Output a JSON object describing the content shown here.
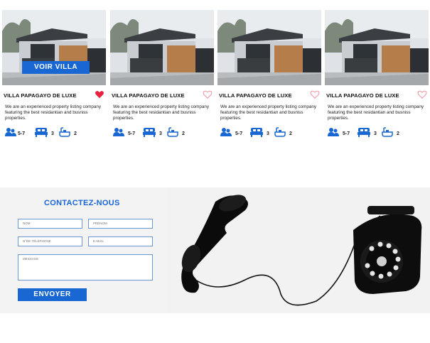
{
  "listings": [
    {
      "title": "VILLA PAPAGAYO DE LUXE",
      "favorited": true,
      "overlay_label": "VOIR VILLA",
      "description": "We are an experienced property listing company featuring the best residantian and busniss properties.",
      "guests": "5-7",
      "beds": "3",
      "baths": "2"
    },
    {
      "title": "VILLA PAPAGAYO DE LUXE",
      "favorited": false,
      "description": "We are an experienced property listing company featuring the best residantian and busniss properties.",
      "guests": "5-7",
      "beds": "3",
      "baths": "2"
    },
    {
      "title": "VILLA PAPAGAYO DE LUXE",
      "favorited": false,
      "description": "We are an experienced property listing company featuring the best residantian and busniss properties.",
      "guests": "5-7",
      "beds": "3",
      "baths": "2"
    },
    {
      "title": "VILLA PAPAGAYO DE LUXE",
      "favorited": false,
      "description": "We are an experienced property listing company featuring the best residantian and busniss properties.",
      "guests": "5-7",
      "beds": "3",
      "baths": "2"
    }
  ],
  "contact": {
    "title": "CONTACTEZ-NOUS",
    "fields": {
      "nom": "NOM",
      "prenom": "PRÉNOM",
      "telephone": "N°DE TÉLÉPHONE",
      "email": "E-MAIL",
      "message": "MESSAGE"
    },
    "submit_label": "ENVOYER"
  },
  "icons": {
    "guests": "users-icon",
    "beds": "bed-icon",
    "baths": "bathtub-icon",
    "favorite": "heart-icon",
    "phone": "rotary-phone-image"
  },
  "colors": {
    "accent": "#1967d2",
    "heart_filled": "#e8213f",
    "heart_outline": "#f08a96"
  }
}
